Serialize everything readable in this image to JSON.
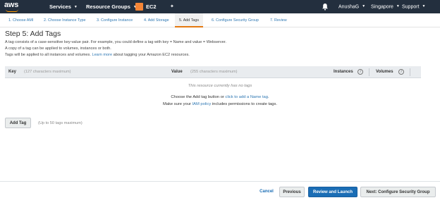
{
  "navbar": {
    "logo_text": "aws",
    "services_label": "Services",
    "resource_groups_label": "Resource Groups",
    "ec2_label": "EC2",
    "user_label": "AnushaG",
    "region_label": "Singapore",
    "support_label": "Support",
    "caret": "▼",
    "pin_glyph": "✦"
  },
  "steps": [
    {
      "label": "1. Choose AMI"
    },
    {
      "label": "2. Choose Instance Type"
    },
    {
      "label": "3. Configure Instance"
    },
    {
      "label": "4. Add Storage"
    },
    {
      "label": "5. Add Tags"
    },
    {
      "label": "6. Configure Security Group"
    },
    {
      "label": "7. Review"
    }
  ],
  "page": {
    "title": "Step 5: Add Tags",
    "desc_line1": "A tag consists of a case-sensitive key-value pair. For example, you could define a tag with key = Name and value = Webserver.",
    "desc_line2": "A copy of a tag can be applied to volumes, instances or both.",
    "desc_line3_prefix": "Tags will be applied to all instances and volumes.",
    "desc_line3_link": "Learn more",
    "desc_line3_suffix": "about tagging your Amazon EC2 resources."
  },
  "table": {
    "key_header": "Key",
    "key_hint": "(127 characters maximum)",
    "value_header": "Value",
    "value_hint": "(255 characters maximum)",
    "instances_header": "Instances",
    "volumes_header": "Volumes",
    "info_glyph": "i",
    "empty_message": "This resource currently has no tags",
    "help_prefix": "Choose the Add tag button or",
    "help_link": "click to add a Name tag",
    "help_suffix": ".",
    "perm_prefix": "Make sure your",
    "perm_link": "IAM policy",
    "perm_suffix": "includes permissions to create tags."
  },
  "add_tag": {
    "button_label": "Add Tag",
    "hint": "(Up to 50 tags maximum)"
  },
  "footer": {
    "cancel_label": "Cancel",
    "previous_label": "Previous",
    "review_launch_label": "Review and Launch",
    "next_label": "Next: Configure Security Group"
  },
  "colors": {
    "navbar_bg": "#232f3e",
    "accent_orange": "#ff9900",
    "link_blue": "#2f78b3",
    "primary_button": "#1a6db5"
  }
}
